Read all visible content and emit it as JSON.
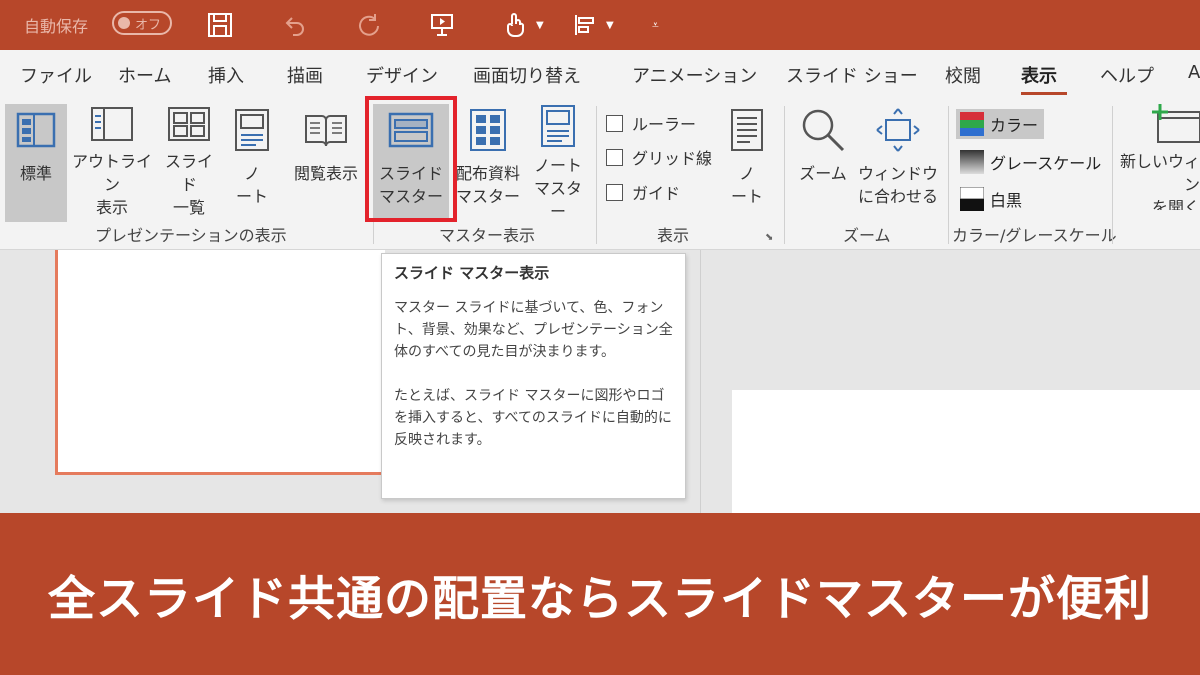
{
  "titlebar": {
    "autosave_label": "自動保存",
    "autosave_toggle": "オフ"
  },
  "tabs": [
    "ファイル",
    "ホーム",
    "挿入",
    "描画",
    "デザイン",
    "画面切り替え",
    "アニメーション",
    "スライド ショー",
    "校閲",
    "表示",
    "ヘルプ",
    "A"
  ],
  "active_tab": "表示",
  "ribbon": {
    "buttons": {
      "normal": "標準",
      "outline": "アウトライン\n表示",
      "slide_sorter": "スライド\n一覧",
      "notes_page": "ノ\nート",
      "reading_view": "閲覧表示",
      "slide_master": "スライド\nマスター",
      "handout_master": "配布資料\nマスター",
      "notes_master": "ノート\nマスター",
      "notes": "ノ\nート",
      "zoom": "ズーム",
      "fit_window": "ウィンドウ\nに合わせる",
      "new_window": "新しいウィン\nを開く"
    },
    "checkboxes": [
      "ルーラー",
      "グリッド線",
      "ガイド"
    ],
    "color_options": [
      "カラー",
      "グレースケール",
      "白黒"
    ],
    "groups": {
      "presentation_views": "プレゼンテーションの表示",
      "master_views": "マスター表示",
      "show": "表示",
      "zoom": "ズーム",
      "color_grayscale": "カラー/グレースケール"
    }
  },
  "tooltip": {
    "title": "スライド マスター表示",
    "para1": "マスター スライドに基づいて、色、フォント、背景、効果など、プレゼンテーション全体のすべての見た目が決まります。",
    "para2": "たとえば、スライド マスターに図形やロゴを挿入すると、すべてのスライドに自動的に反映されます。"
  },
  "banner": {
    "caption": "全スライド共通の配置ならスライドマスターが便利"
  },
  "colors": {
    "accent": "#b7472a",
    "highlight": "#e3222b"
  }
}
